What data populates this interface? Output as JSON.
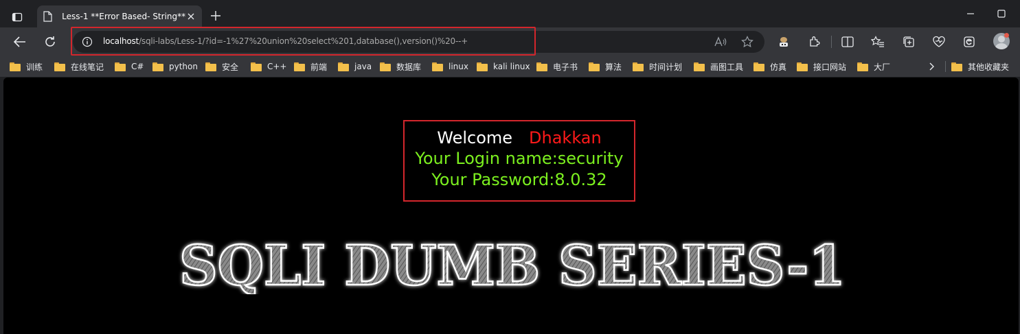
{
  "window": {
    "tab_title": "Less-1 **Error Based- String**"
  },
  "toolbar": {
    "url_host": "localhost",
    "url_path": "/sqli-labs/Less-1/?id=-1%27%20union%20select%201,database(),version()%20--+"
  },
  "bookmarks": [
    {
      "label": "训练"
    },
    {
      "label": "在线笔记"
    },
    {
      "label": "C#"
    },
    {
      "label": "python"
    },
    {
      "label": "安全"
    },
    {
      "label": "C++"
    },
    {
      "label": "前端"
    },
    {
      "label": "java"
    },
    {
      "label": "数据库"
    },
    {
      "label": "linux"
    },
    {
      "label": "kali linux"
    },
    {
      "label": "电子书"
    },
    {
      "label": "算法"
    },
    {
      "label": "时间计划"
    },
    {
      "label": "画图工具"
    },
    {
      "label": "仿真"
    },
    {
      "label": "接口网站"
    },
    {
      "label": "大厂"
    }
  ],
  "other_bookmarks": "其他收藏夹",
  "page": {
    "welcome": "Welcome",
    "username": "Dhakkan",
    "login_name": "Your Login name:security",
    "password": "Your Password:8.0.32",
    "banner": "SQLI DUMB SERIES-1"
  },
  "colors": {
    "page_background": "#000000",
    "highlight_box": "#d4262c",
    "username_red": "#ff1a1a",
    "login_green": "#7cf01f"
  }
}
